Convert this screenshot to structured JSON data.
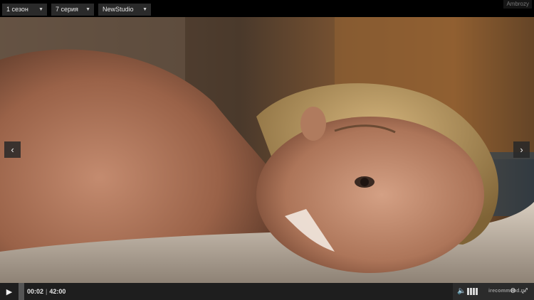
{
  "topbar": {
    "season": "1 сезон",
    "episode": "7 серия",
    "studio": "NewStudio",
    "caret": "▼",
    "watermark": "Ambrozy"
  },
  "video": {
    "description_icon": "video-frame",
    "prev_arrow": "‹",
    "next_arrow": "›"
  },
  "controls": {
    "play": "▶",
    "current_time": "00:02",
    "separator": "|",
    "total_time": "42:00",
    "volume_icon": "🔈",
    "watermark": "irecommend.ru",
    "settings": "⚙",
    "fullscreen": "⤢"
  },
  "progress": {
    "played_fraction": 0.0
  }
}
